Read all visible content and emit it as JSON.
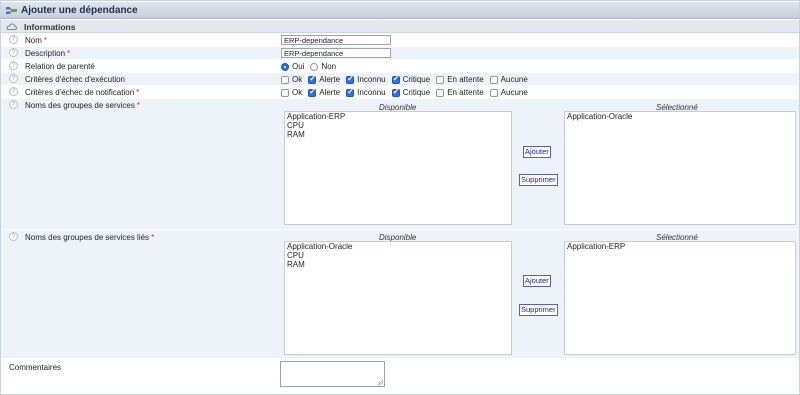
{
  "title": "Ajouter une dépendance",
  "section": "Informations",
  "fields": {
    "nom": {
      "label": "Nom",
      "value": "ERP-dependance"
    },
    "description": {
      "label": "Description",
      "value": "ERP-dependance"
    },
    "relation": {
      "label": "Relation de parenté",
      "oui": "Oui",
      "non": "Non",
      "selected": "Oui"
    },
    "exec": {
      "label": "Critères d'échec d'exécution",
      "options": [
        {
          "label": "Ok",
          "checked": false
        },
        {
          "label": "Alerte",
          "checked": true
        },
        {
          "label": "Inconnu",
          "checked": true
        },
        {
          "label": "Critique",
          "checked": true
        },
        {
          "label": "En attente",
          "checked": false
        },
        {
          "label": "Aucune",
          "checked": false
        }
      ]
    },
    "notif": {
      "label": "Critères d'échec de notification",
      "options": [
        {
          "label": "Ok",
          "checked": false
        },
        {
          "label": "Alerte",
          "checked": true
        },
        {
          "label": "Inconnu",
          "checked": true
        },
        {
          "label": "Critique",
          "checked": true
        },
        {
          "label": "En attente",
          "checked": false
        },
        {
          "label": "Aucune",
          "checked": false
        }
      ]
    },
    "groups": {
      "label": "Noms des groupes de services",
      "available_header": "Disponible",
      "selected_header": "Sélectionné",
      "available": [
        "Application-ERP",
        "CPU",
        "RAM"
      ],
      "selected": [
        "Application-Oracle"
      ],
      "add": "Ajouter",
      "remove": "Supprimer"
    },
    "linked": {
      "label": "Noms des groupes de services liés",
      "available_header": "Disponible",
      "selected_header": "Sélectionné",
      "available": [
        "Application-Oracle",
        "CPU",
        "RAM"
      ],
      "selected": [
        "Application-ERP"
      ],
      "add": "Ajouter",
      "remove": "Supprimer"
    },
    "comments": {
      "label": "Commentaires",
      "value": ""
    }
  },
  "required_marker": "*",
  "help_glyph": "?",
  "colors": {
    "title_bar": "#c5cedb",
    "row_alt": "#eef3fa",
    "required": "#d12c2c",
    "button_text": "#1a1ab0"
  }
}
